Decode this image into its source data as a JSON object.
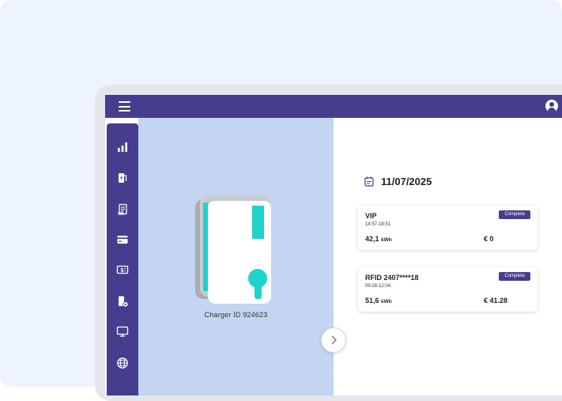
{
  "sidebar": {
    "items": [
      {
        "id": "analytics",
        "icon": "bar-chart-icon"
      },
      {
        "id": "chargers",
        "icon": "charging-station-icon"
      },
      {
        "id": "sessions",
        "icon": "receipt-icon"
      },
      {
        "id": "payments",
        "icon": "credit-card-icon"
      },
      {
        "id": "tariffs",
        "icon": "money-icon"
      },
      {
        "id": "stations",
        "icon": "station-settings-icon"
      },
      {
        "id": "display",
        "icon": "monitor-icon"
      },
      {
        "id": "network",
        "icon": "globe-icon"
      }
    ]
  },
  "charger": {
    "label": "Charger ID 924623"
  },
  "sessions": {
    "date": "11/07/2025",
    "items": [
      {
        "title": "VIP",
        "time": "14:57-18:51",
        "status": "Complete",
        "energy": "42,1",
        "energy_unit": "kWh",
        "cost": "€ 0"
      },
      {
        "title": "RFID 2407****18",
        "time": "09:28-12:04",
        "status": "Complete",
        "energy": "51,6",
        "energy_unit": "kWh",
        "cost": "€ 41.28"
      }
    ]
  },
  "colors": {
    "brand": "#463d8e",
    "panel": "#c3d5f1",
    "accent": "#1fd3cc",
    "background": "#eef4ff"
  }
}
